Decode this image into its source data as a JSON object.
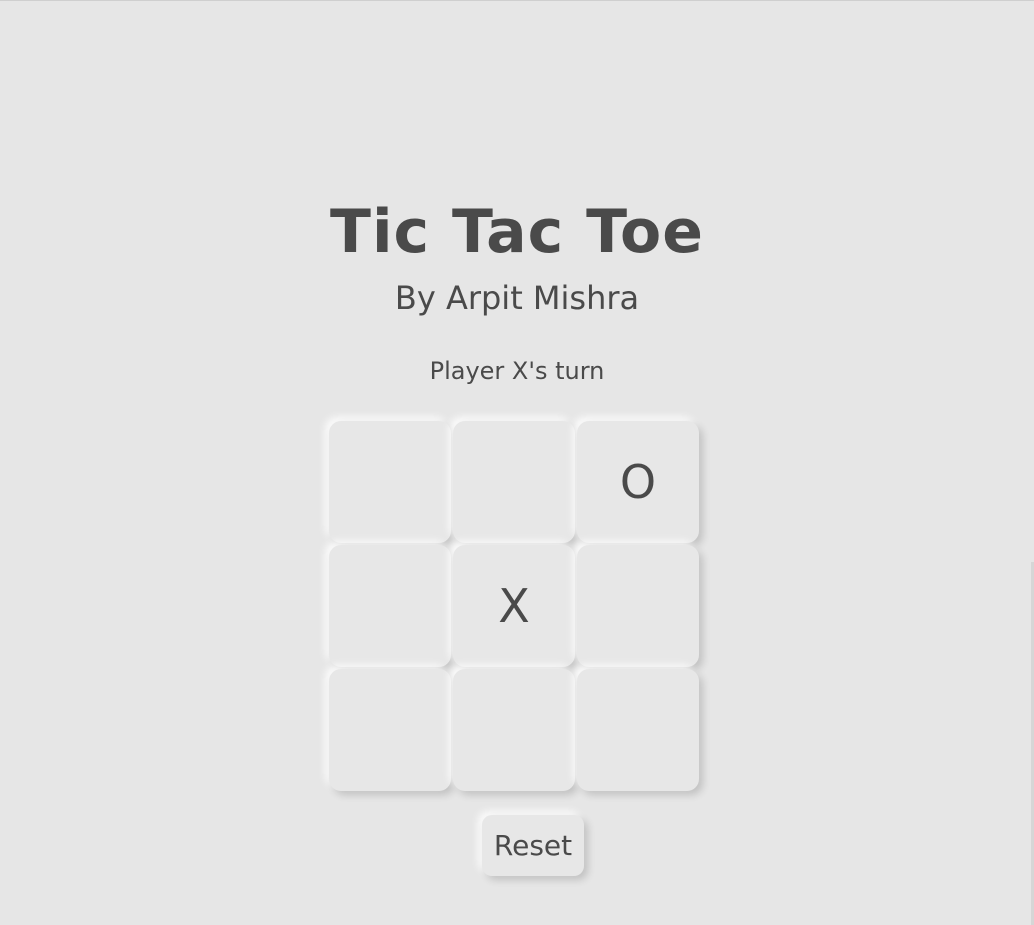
{
  "title": "Tic Tac Toe",
  "subtitle": "By Arpit Mishra",
  "status": "Player X's turn",
  "board": {
    "cells": [
      "",
      "",
      "O",
      "",
      "X",
      "",
      "",
      "",
      ""
    ]
  },
  "reset_label": "Reset",
  "colors": {
    "background": "#e6e6e6",
    "text": "#4a4a4a",
    "cell": "#e7e7e7"
  }
}
